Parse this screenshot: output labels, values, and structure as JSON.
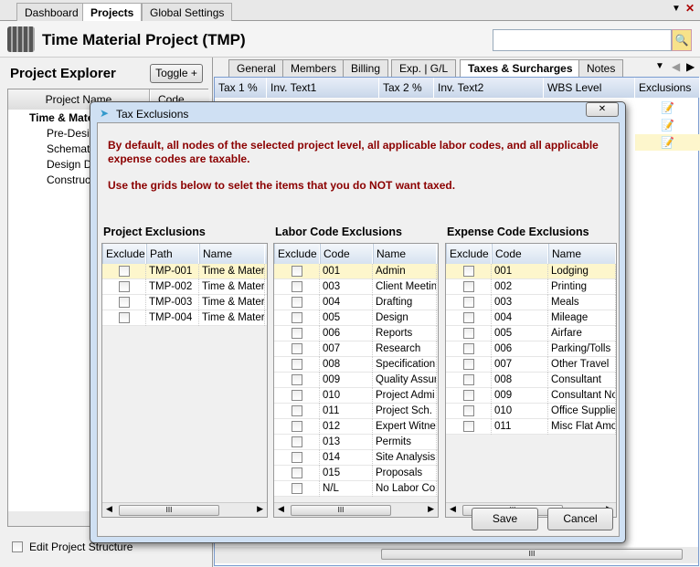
{
  "top_tabs": [
    "Dashboard",
    "Projects",
    "Global Settings"
  ],
  "active_top_tab": "Projects",
  "header": {
    "title": "Time  Material Project (TMP)",
    "search_value": ""
  },
  "explorer": {
    "title": "Project Explorer",
    "toggle_label": "Toggle +",
    "columns": [
      "Project Name",
      "Code"
    ],
    "tree": [
      "Time & Mate",
      "Pre-Desig",
      "Schemati",
      "Design D",
      "Construc"
    ],
    "edit_structure_label": "Edit Project Structure"
  },
  "project_tabs": [
    "General",
    "Members",
    "Billing",
    "Exp. | G/L",
    "Taxes & Surcharges",
    "Notes"
  ],
  "active_project_tab": "Taxes & Surcharges",
  "main_grid_columns": [
    "Tax 1 %",
    "Inv. Text1",
    "Tax 2 %",
    "Inv. Text2",
    "WBS Level",
    "Exclusions"
  ],
  "dialog": {
    "title": "Tax Exclusions",
    "message1": "By default, all nodes of the selected project level, all applicable labor codes, and all applicable expense codes are taxable.",
    "message2": "Use the grids below to selet the items that you do NOT want taxed.",
    "save_label": "Save",
    "cancel_label": "Cancel",
    "grids": [
      {
        "title": "Project Exclusions",
        "columns": [
          "Exclude",
          "Path",
          "Name"
        ],
        "rows": [
          [
            "TMP-001",
            "Time & Mater"
          ],
          [
            "TMP-002",
            "Time & Mater"
          ],
          [
            "TMP-003",
            "Time & Mater"
          ],
          [
            "TMP-004",
            "Time & Mater"
          ]
        ]
      },
      {
        "title": "Labor Code Exclusions",
        "columns": [
          "Exclude",
          "Code",
          "Name"
        ],
        "rows": [
          [
            "001",
            "Admin"
          ],
          [
            "003",
            "Client Meetin"
          ],
          [
            "004",
            "Drafting"
          ],
          [
            "005",
            "Design"
          ],
          [
            "006",
            "Reports"
          ],
          [
            "007",
            "Research"
          ],
          [
            "008",
            "Specification"
          ],
          [
            "009",
            "Quality Assur"
          ],
          [
            "010",
            "Project Admi"
          ],
          [
            "011",
            "Project Sch."
          ],
          [
            "012",
            "Expert Witne"
          ],
          [
            "013",
            "Permits"
          ],
          [
            "014",
            "Site Analysis"
          ],
          [
            "015",
            "Proposals"
          ],
          [
            "N/L",
            "No Labor Co"
          ]
        ]
      },
      {
        "title": "Expense Code Exclusions",
        "columns": [
          "Exclude",
          "Code",
          "Name"
        ],
        "rows": [
          [
            "001",
            "Lodging"
          ],
          [
            "002",
            "Printing"
          ],
          [
            "003",
            "Meals"
          ],
          [
            "004",
            "Mileage"
          ],
          [
            "005",
            "Airfare"
          ],
          [
            "006",
            "Parking/Tolls"
          ],
          [
            "007",
            "Other Travel"
          ],
          [
            "008",
            "Consultant"
          ],
          [
            "009",
            "Consultant Nor"
          ],
          [
            "010",
            "Office Supplie"
          ],
          [
            "011",
            "Misc Flat Amo"
          ]
        ]
      }
    ]
  }
}
